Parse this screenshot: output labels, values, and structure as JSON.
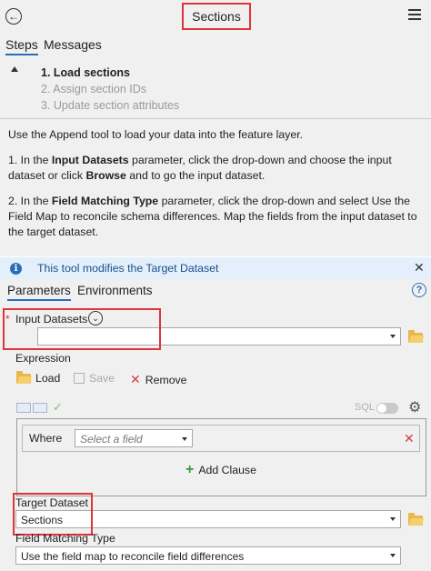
{
  "header": {
    "title": "Sections"
  },
  "steps_tabs": {
    "steps": "Steps",
    "messages": "Messages"
  },
  "steps": [
    {
      "label": "1.  Load sections"
    },
    {
      "label": "2.  Assign section IDs"
    },
    {
      "label": "3.  Update section attributes"
    }
  ],
  "description": {
    "p1": "Use the Append tool to load your data into the feature layer.",
    "p2_prefix": "1. In the ",
    "p2_bold1": "Input Datasets",
    "p2_mid": " parameter, click the drop-down and choose the input dataset or click ",
    "p2_bold2": "Browse",
    "p2_suffix": " and to go the input dataset.",
    "p3_prefix": "2. In the ",
    "p3_bold": "Field Matching Type",
    "p3_suffix": " parameter, click the drop-down and select Use the Field Map to reconcile schema differences. Map the fields from the input dataset to the target dataset."
  },
  "info": {
    "message": "This tool modifies the Target Dataset"
  },
  "param_tabs": {
    "parameters": "Parameters",
    "environments": "Environments"
  },
  "params": {
    "input_datasets_label": "Input Datasets",
    "input_datasets_value": "",
    "expression_label": "Expression",
    "load_label": "Load",
    "save_label": "Save",
    "remove_label": "Remove",
    "sql_label": "SQL",
    "where_label": "Where",
    "field_placeholder": "Select a field",
    "add_clause_label": "Add Clause",
    "target_dataset_label": "Target Dataset",
    "target_dataset_value": "Sections",
    "field_matching_label": "Field Matching Type",
    "field_matching_value": "Use the field map to reconcile field differences"
  },
  "colors": {
    "accent": "#2a6ebb",
    "highlight": "#e0333a",
    "info_bg": "#e3f0fb"
  }
}
